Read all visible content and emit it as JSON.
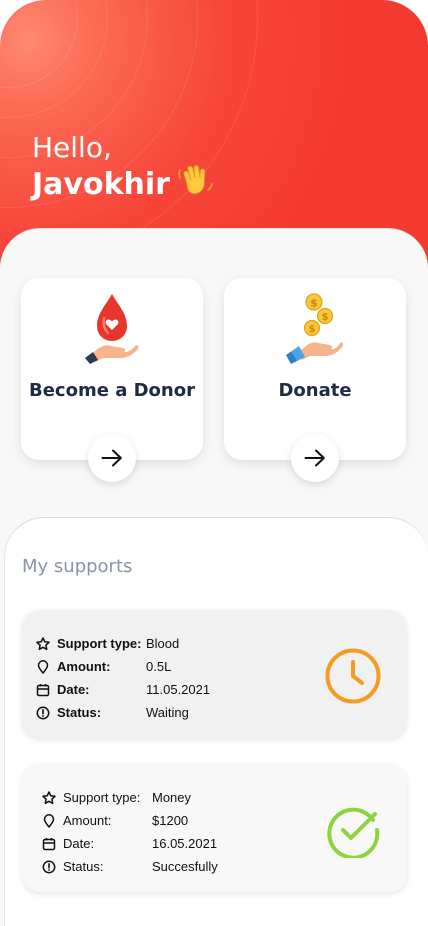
{
  "header": {
    "greeting": "Hello,",
    "user_name": "Javokhir",
    "wave_emoji": "waving-hand-icon"
  },
  "actions": [
    {
      "title": "Become a Donor",
      "icon": "blood-drop-hand-icon",
      "arrow_icon": "arrow-right-icon"
    },
    {
      "title": "Donate",
      "icon": "coins-hand-icon",
      "arrow_icon": "arrow-right-icon"
    }
  ],
  "supports": {
    "title": "My supports",
    "items": [
      {
        "fields": [
          {
            "icon": "star-icon",
            "label": "Support type:",
            "value": "Blood"
          },
          {
            "icon": "location-pin-icon",
            "label": "Amount:",
            "value": "0.5L"
          },
          {
            "icon": "calendar-icon",
            "label": "Date:",
            "value": "11.05.2021"
          },
          {
            "icon": "alert-circle-icon",
            "label": "Status:",
            "value": "Waiting"
          }
        ],
        "status_icon": "clock-icon",
        "status_color": "#f59b23"
      },
      {
        "fields": [
          {
            "icon": "star-icon",
            "label": "Support type:",
            "value": "Money"
          },
          {
            "icon": "location-pin-icon",
            "label": "Amount:",
            "value": "$1200"
          },
          {
            "icon": "calendar-icon",
            "label": "Date:",
            "value": "16.05.2021"
          },
          {
            "icon": "alert-circle-icon",
            "label": "Status:",
            "value": "Succesfully"
          }
        ],
        "status_icon": "check-circle-icon",
        "status_color": "#8bd43c"
      }
    ]
  },
  "colors": {
    "header_red": "#f33a30",
    "text_dark": "#1f2a44",
    "muted": "#8a93a6"
  }
}
